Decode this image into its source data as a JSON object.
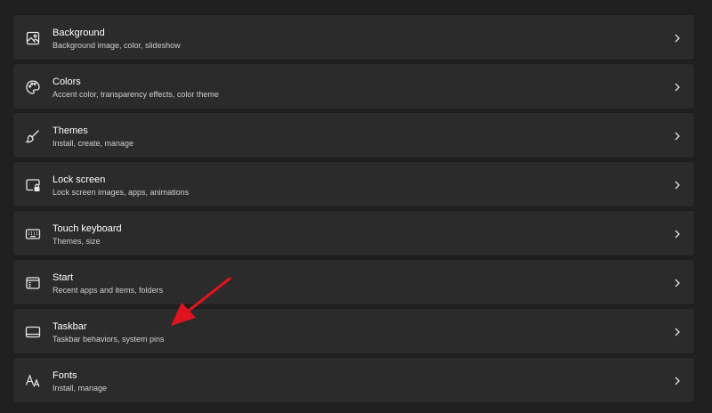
{
  "settings": {
    "items": [
      {
        "title": "Background",
        "subtitle": "Background image, color, slideshow",
        "icon": "picture-icon"
      },
      {
        "title": "Colors",
        "subtitle": "Accent color, transparency effects, color theme",
        "icon": "palette-icon"
      },
      {
        "title": "Themes",
        "subtitle": "Install, create, manage",
        "icon": "brush-icon"
      },
      {
        "title": "Lock screen",
        "subtitle": "Lock screen images, apps, animations",
        "icon": "lock-screen-icon"
      },
      {
        "title": "Touch keyboard",
        "subtitle": "Themes, size",
        "icon": "keyboard-icon"
      },
      {
        "title": "Start",
        "subtitle": "Recent apps and items, folders",
        "icon": "start-icon"
      },
      {
        "title": "Taskbar",
        "subtitle": "Taskbar behaviors, system pins",
        "icon": "taskbar-icon"
      },
      {
        "title": "Fonts",
        "subtitle": "Install, manage",
        "icon": "fonts-icon"
      }
    ]
  },
  "colors": {
    "background": "#202020",
    "card": "#2b2b2b",
    "annotation_arrow": "#e0141e"
  }
}
